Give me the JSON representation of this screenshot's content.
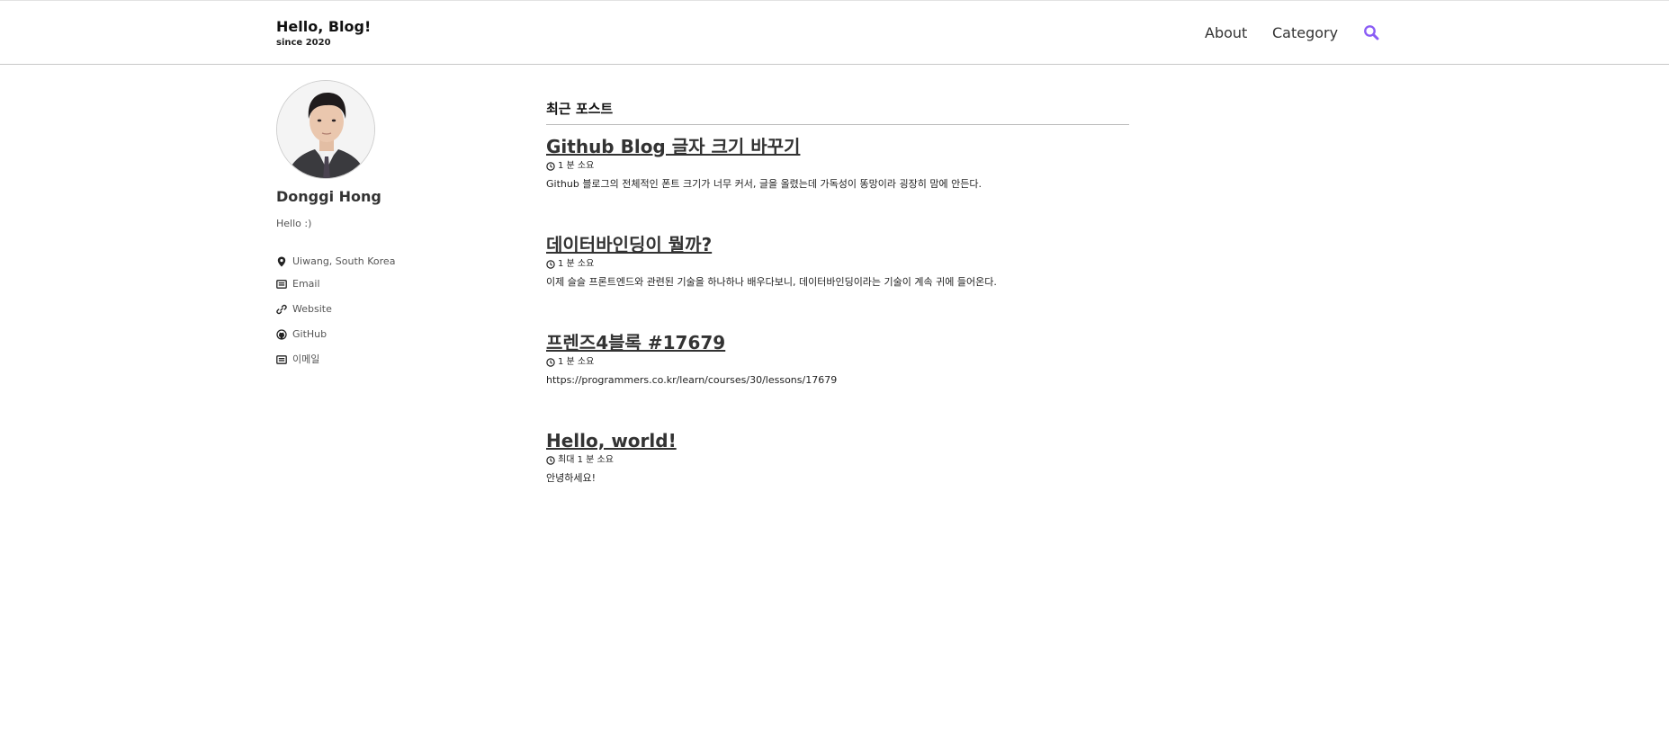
{
  "header": {
    "site_title": "Hello, Blog!",
    "site_subtitle": "since 2020",
    "nav": [
      {
        "label": "About"
      },
      {
        "label": "Category"
      }
    ],
    "search_icon": "search-icon"
  },
  "sidebar": {
    "author_name": "Donggi Hong",
    "bio": "Hello :)",
    "links": [
      {
        "icon": "map-marker-icon",
        "label": "Uiwang, South Korea"
      },
      {
        "icon": "envelope-icon",
        "label": "Email"
      },
      {
        "icon": "link-icon",
        "label": "Website"
      },
      {
        "icon": "github-icon",
        "label": "GitHub"
      },
      {
        "icon": "envelope-icon",
        "label": "이메일"
      }
    ]
  },
  "main": {
    "section_title": "최근 포스트",
    "posts": [
      {
        "title": "Github Blog 글자 크기 바꾸기",
        "read_time": "1 분 소요",
        "excerpt": "Github 블로그의 전체적인 폰트 크기가 너무 커서, 글을 올렸는데 가독성이 똥망이라 굉장히 맘에 안든다."
      },
      {
        "title": "데이터바인딩이 뭘까?",
        "read_time": "1 분 소요",
        "excerpt": "이제 슬슬 프론트엔드와 관련된 기술을 하나하나 배우다보니, 데이터바인딩이라는 기술이 계속 귀에 들어온다."
      },
      {
        "title": "프렌즈4블록 #17679",
        "read_time": "1 분 소요",
        "excerpt": "https://programmers.co.kr/learn/courses/30/lessons/17679"
      },
      {
        "title": "Hello, world!",
        "read_time": "최대 1 분 소요",
        "excerpt": "안녕하세요!"
      }
    ]
  },
  "colors": {
    "accent": "#8a5cf5",
    "text": "#333333",
    "border": "#c8c8c8"
  }
}
